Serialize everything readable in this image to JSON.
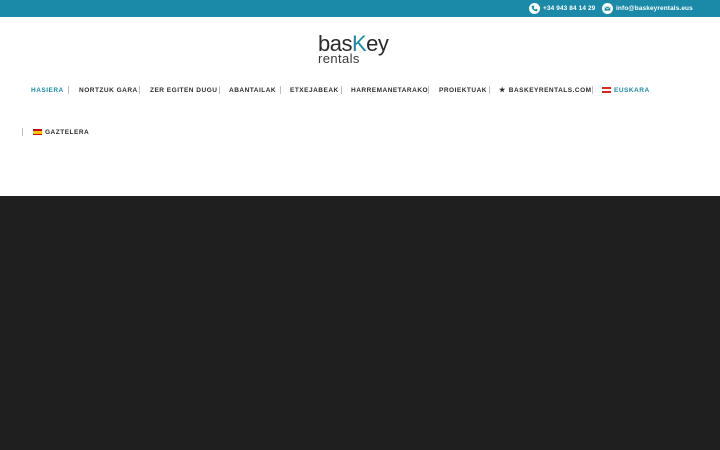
{
  "topbar": {
    "phone": "+34 943 84 14 29",
    "email": "info@baskeyrentals.eus",
    "phone_icon": "phone-icon",
    "email_icon": "envelope-icon",
    "color": "#1a8aa8"
  },
  "logo": {
    "text_main": "bas",
    "text_k": "K",
    "text_rest": "ey",
    "text_sub": "rentals",
    "accent_color": "#1a8aa8"
  },
  "nav": {
    "items": [
      {
        "label": "HASIERA",
        "active": true
      },
      {
        "label": "NORTZUK GARA"
      },
      {
        "label": "ZER EGITEN DUGU"
      },
      {
        "label": "ABANTAILAK"
      },
      {
        "label": "ETXEJABEAK"
      },
      {
        "label": "HARREMANETARAKO"
      },
      {
        "label": "PROIEKTUAK"
      },
      {
        "label": "BASKEYRENTALS.COM",
        "icon": "star-icon"
      },
      {
        "label": "EUSKARA",
        "icon": "basque-flag-icon",
        "active": true
      },
      {
        "label": "GAZTELERA",
        "icon": "spain-flag-icon"
      }
    ]
  },
  "hero": {
    "background": "#1f1f1f"
  }
}
